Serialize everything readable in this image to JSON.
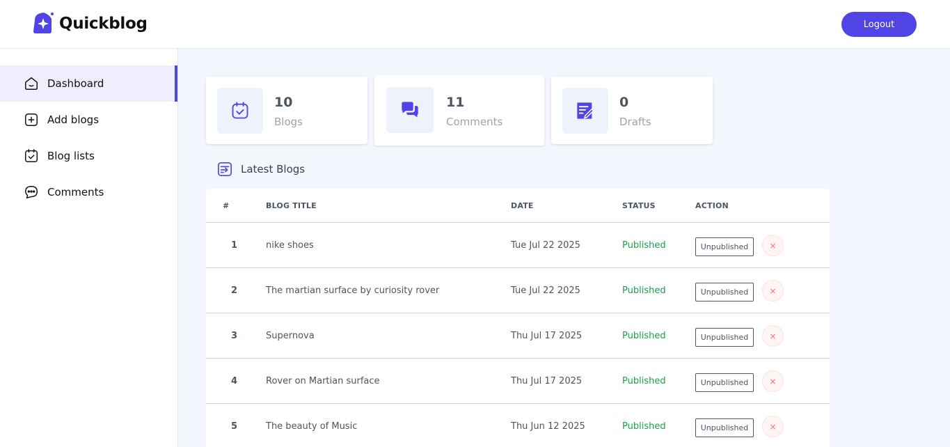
{
  "header": {
    "logo_text": "Quickblog",
    "logout_label": "Logout"
  },
  "sidebar": {
    "items": [
      {
        "label": "Dashboard",
        "icon": "home-icon",
        "active": true
      },
      {
        "label": "Add blogs",
        "icon": "add-square-icon",
        "active": false
      },
      {
        "label": "Blog lists",
        "icon": "calendar-check-icon",
        "active": false
      },
      {
        "label": "Comments",
        "icon": "chat-bubble-icon",
        "active": false
      }
    ]
  },
  "stats": [
    {
      "count": "10",
      "label": "Blogs",
      "icon": "calendar-check-icon"
    },
    {
      "count": "11",
      "label": "Comments",
      "icon": "chat-bubbles-icon"
    },
    {
      "count": "0",
      "label": "Drafts",
      "icon": "edit-document-icon"
    }
  ],
  "latest": {
    "title": "Latest Blogs"
  },
  "table": {
    "headers": [
      "#",
      "BLOG TITLE",
      "DATE",
      "STATUS",
      "ACTION"
    ],
    "rows": [
      {
        "num": "1",
        "title": "nike shoes",
        "date": "Tue Jul 22 2025",
        "status": "Published",
        "action": "Unpublished",
        "delete": "×"
      },
      {
        "num": "2",
        "title": "The martian surface by curiosity rover",
        "date": "Tue Jul 22 2025",
        "status": "Published",
        "action": "Unpublished",
        "delete": "×"
      },
      {
        "num": "3",
        "title": "Supernova",
        "date": "Thu Jul 17 2025",
        "status": "Published",
        "action": "Unpublished",
        "delete": "×"
      },
      {
        "num": "4",
        "title": "Rover on Martian surface",
        "date": "Thu Jul 17 2025",
        "status": "Published",
        "action": "Unpublished",
        "delete": "×"
      },
      {
        "num": "5",
        "title": "The beauty of Music",
        "date": "Thu Jun 12 2025",
        "status": "Published",
        "action": "Unpublished",
        "delete": "×"
      }
    ]
  },
  "colors": {
    "accent": "#5044e5",
    "published": "#16a34a",
    "main_bg": "#f3f6fd"
  }
}
